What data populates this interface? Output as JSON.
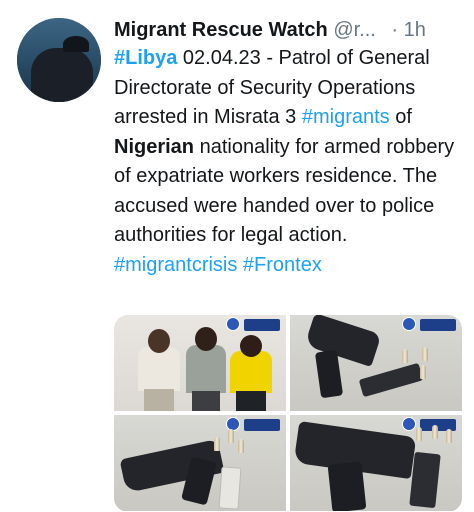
{
  "tweet": {
    "author_name": "Migrant Rescue Watch",
    "author_handle": "@r...",
    "separator": "·",
    "time": "1h",
    "segments": [
      {
        "text": "#Libya",
        "style": "hashtag-bold"
      },
      {
        "text": " 02.04.23 - Patrol of General Directorate of Security Operations arrested in Misrata 3 ",
        "style": "normal"
      },
      {
        "text": "#migrants",
        "style": "hashtag"
      },
      {
        "text": " of ",
        "style": "normal"
      },
      {
        "text": "Nigerian",
        "style": "bold"
      },
      {
        "text": " nationality for armed robbery of expatriate workers residence. The accused were handed over to police authorities for legal action. ",
        "style": "normal"
      },
      {
        "text": "#migrantcrisis",
        "style": "hashtag"
      },
      {
        "text": " ",
        "style": "normal"
      },
      {
        "text": "#Frontex",
        "style": "hashtag"
      }
    ]
  },
  "media": [
    {
      "name": "photo-suspects"
    },
    {
      "name": "photo-pistol-magazine-rounds"
    },
    {
      "name": "photo-pistol-rounds"
    },
    {
      "name": "photo-pistol-magazine-closeup"
    }
  ],
  "colors": {
    "hashtag": "#1da1f2",
    "text": "#14171a",
    "muted": "#657786"
  }
}
